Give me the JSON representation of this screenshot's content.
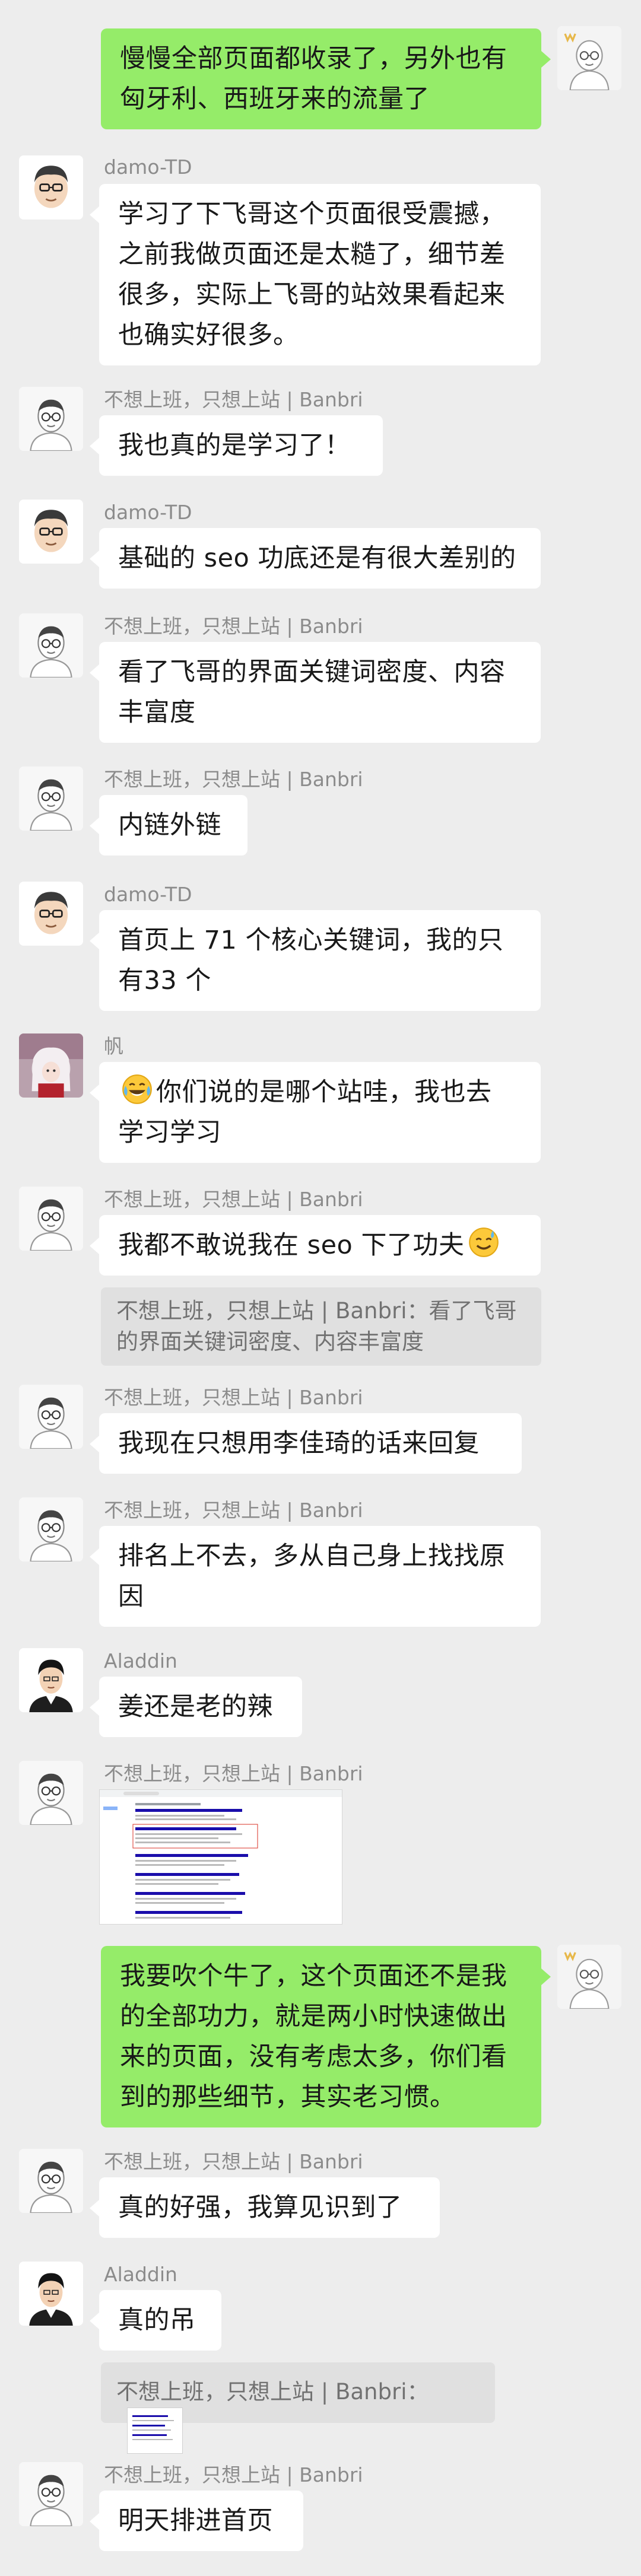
{
  "messages": [
    {
      "sender": "me",
      "lines": [
        "慢慢全部页面都收录了，另外也有",
        "匈牙利、西班牙来的流量了"
      ]
    },
    {
      "sender": "damo-TD",
      "lines": [
        "学习了下飞哥这个页面很受震撼，",
        "之前我做页面还是太糙了，细节差",
        "很多，实际上飞哥的站效果看起来",
        "也确实好很多。"
      ]
    },
    {
      "sender": "不想上班，只想上站 | Banbri",
      "lines": [
        "我也真的是学习了！"
      ]
    },
    {
      "sender": "damo-TD",
      "lines": [
        "基础的 seo 功底还是有很大差别的"
      ]
    },
    {
      "sender": "不想上班，只想上站 | Banbri",
      "lines": [
        "看了飞哥的界面关键词密度、内容",
        "丰富度"
      ]
    },
    {
      "sender": "不想上班，只想上站 | Banbri",
      "lines": [
        "内链外链"
      ]
    },
    {
      "sender": "damo-TD",
      "lines": [
        "首页上 71 个核心关键词，我的只",
        "有33 个"
      ]
    },
    {
      "sender": "帆",
      "lines": [
        "你们说的是哪个站哇，我也去",
        "学习学习"
      ],
      "emoji_prefix": "laughing-tears-emoji"
    },
    {
      "sender": "不想上班，只想上站 | Banbri",
      "lines": [
        "我都不敢说我在 seo 下了功夫"
      ],
      "emoji_suffix": "sweat-smile-emoji",
      "quote": [
        "不想上班，只想上站 | Banbri：看了飞哥",
        "的界面关键词密度、内容丰富度"
      ]
    },
    {
      "sender": "不想上班，只想上站 | Banbri",
      "lines": [
        "我现在只想用李佳琦的话来回复"
      ]
    },
    {
      "sender": "不想上班，只想上站 | Banbri",
      "lines": [
        "排名上不去，多从自己身上找找原",
        "因"
      ]
    },
    {
      "sender": "Aladdin",
      "lines": [
        "姜还是老的辣"
      ]
    },
    {
      "sender": "不想上班，只想上站 | Banbri",
      "image": "search-results-screenshot"
    },
    {
      "sender": "me",
      "lines": [
        "我要吹个牛了，这个页面还不是我",
        "的全部功力，就是两小时快速做出",
        "来的页面，没有考虑太多，你们看",
        "到的那些细节，其实老习惯。"
      ]
    },
    {
      "sender": "不想上班，只想上站 | Banbri",
      "lines": [
        "真的好强，我算见识到了"
      ]
    },
    {
      "sender": "Aladdin",
      "lines": [
        "真的吊"
      ],
      "quote": [
        "不想上班，只想上站 | Banbri："
      ]
    },
    {
      "sender": "不想上班，只想上站 | Banbri",
      "lines": [
        "明天排进首页"
      ]
    }
  ],
  "colors": {
    "background": "#ededed",
    "bubble_in": "#ffffff",
    "bubble_out": "#95ec69",
    "name": "#8c8c8c",
    "quote_bg": "#e0e0e0"
  }
}
